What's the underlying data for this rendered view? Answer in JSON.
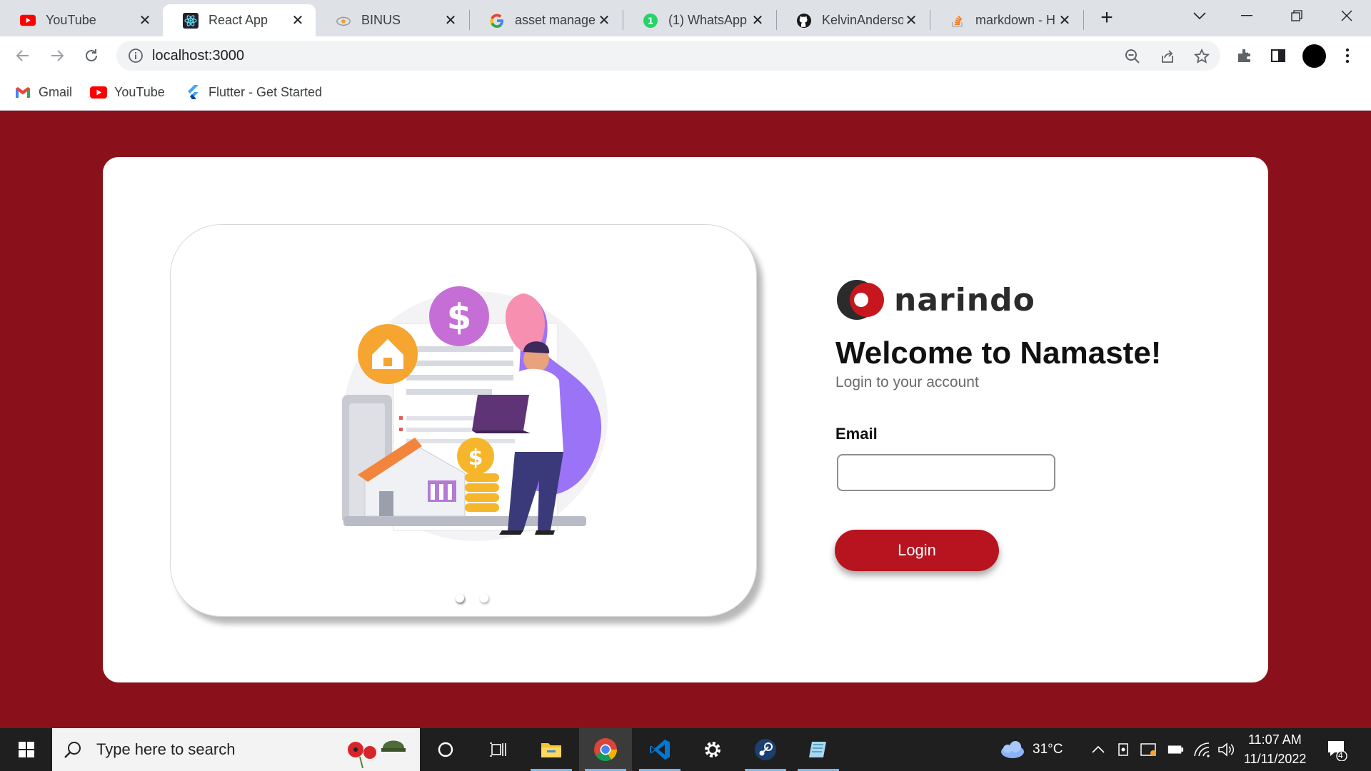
{
  "browser": {
    "tabs": [
      {
        "title": "YouTube",
        "favicon": "youtube-icon",
        "active": false
      },
      {
        "title": "React App",
        "favicon": "react-icon",
        "active": true
      },
      {
        "title": "BINUS",
        "favicon": "binus-icon",
        "active": false
      },
      {
        "title": "asset managem",
        "favicon": "google-icon",
        "active": false
      },
      {
        "title": "(1) WhatsApp",
        "favicon": "whatsapp-icon",
        "active": false
      },
      {
        "title": "KelvinAnderson",
        "favicon": "github-icon",
        "active": false
      },
      {
        "title": "markdown - H",
        "favicon": "stackoverflow-icon",
        "active": false
      }
    ],
    "url": "localhost:3000",
    "bookmarks": [
      {
        "label": "Gmail",
        "icon": "gmail-icon"
      },
      {
        "label": "YouTube",
        "icon": "youtube-icon"
      },
      {
        "label": "Flutter - Get Started",
        "icon": "flutter-icon"
      }
    ]
  },
  "login": {
    "brand": "narindo",
    "welcome": "Welcome to Namaste!",
    "subtitle": "Login to your account",
    "email_label": "Email",
    "email_value": "",
    "login_button": "Login",
    "carousel_active_index": 0,
    "carousel_count": 2
  },
  "taskbar": {
    "search_placeholder": "Type here to search",
    "apps": [
      "cortana-icon",
      "task-view-icon",
      "file-explorer-icon",
      "chrome-icon",
      "vscode-icon",
      "settings-icon",
      "steam-icon",
      "notepad-icon"
    ],
    "weather": "31°C",
    "time": "11:07 AM",
    "date": "11/11/2022",
    "notifications": "4"
  },
  "colors": {
    "page_bg": "#8a111b",
    "button": "#b8141f"
  }
}
